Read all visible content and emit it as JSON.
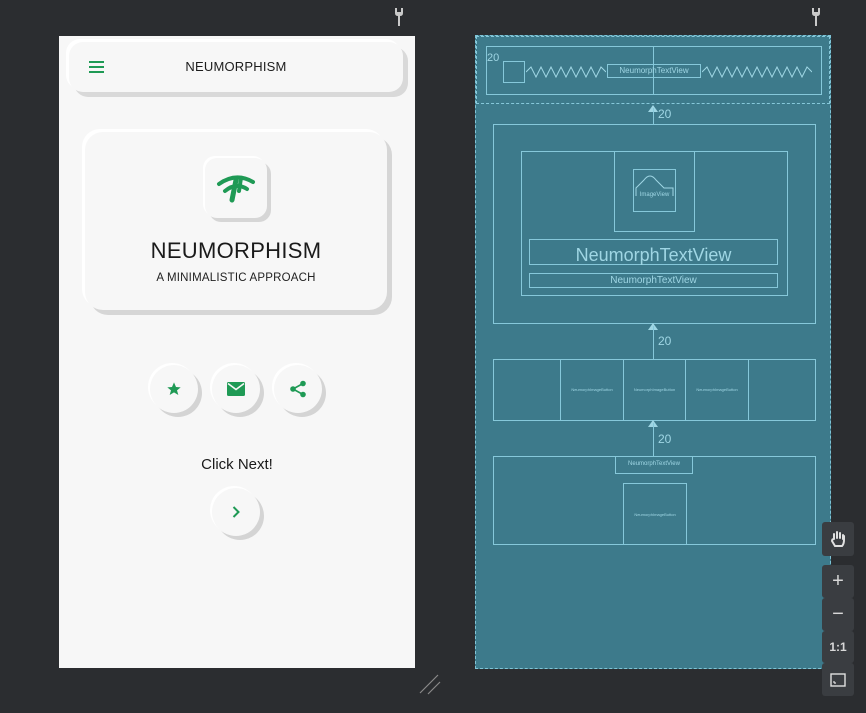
{
  "app": {
    "toolbar_title": "NEUMORPHISM",
    "card_title": "NEUMORPHISM",
    "card_subtitle": "A MINIMALISTIC APPROACH",
    "click_next": "Click Next!",
    "accent_color": "#1f9a55"
  },
  "blueprint": {
    "toolbar_text": "NeumorphTextView",
    "margin_value": "20",
    "image_label": "ImageView",
    "title_text": "NeumorphTextView",
    "subtitle_text": "NeumorphTextView",
    "button_labels": [
      "NeumorphImageButton",
      "NeumorphImageButton",
      "NeumorphImageButton"
    ],
    "bottom_text": "NeumorphTextView",
    "bottom_button": "NeumorphImageButton",
    "margins": [
      "20",
      "20",
      "20"
    ]
  },
  "tools": {
    "pan_icon": "hand-icon",
    "zoom_in": "+",
    "zoom_out": "−",
    "actual_size": "1:1",
    "fit_icon": "fit-screen-icon"
  }
}
